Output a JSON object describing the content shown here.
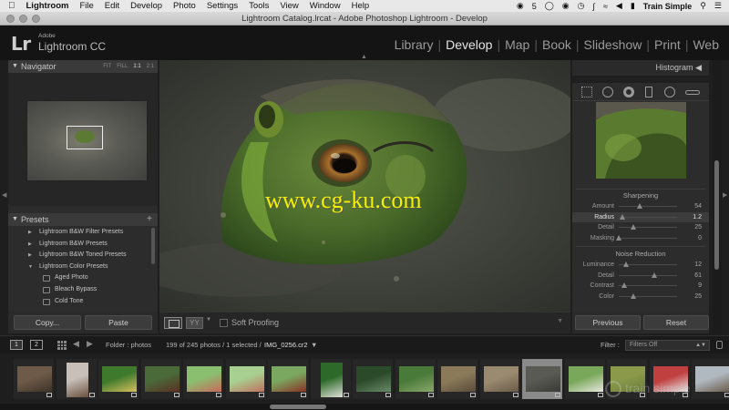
{
  "menubar": {
    "app": "Lightroom",
    "items": [
      "File",
      "Edit",
      "Develop",
      "Photo",
      "Settings",
      "Tools",
      "View",
      "Window",
      "Help"
    ],
    "cc_badge": "5",
    "user": "Train Simple"
  },
  "window": {
    "title": "Lightroom Catalog.lrcat - Adobe Photoshop Lightroom - Develop"
  },
  "identity": {
    "logo": "Lr",
    "adobe": "Adobe",
    "product": "Lightroom CC"
  },
  "modules": [
    {
      "label": "Library",
      "active": false
    },
    {
      "label": "Develop",
      "active": true
    },
    {
      "label": "Map",
      "active": false
    },
    {
      "label": "Book",
      "active": false
    },
    {
      "label": "Slideshow",
      "active": false
    },
    {
      "label": "Print",
      "active": false
    },
    {
      "label": "Web",
      "active": false
    }
  ],
  "navigator": {
    "title": "Navigator",
    "options": [
      "FIT",
      "FILL",
      "1:1",
      "2:1"
    ],
    "selected_option": "1:1"
  },
  "presets": {
    "title": "Presets",
    "add": "+",
    "items": [
      {
        "label": "Lightroom B&W Filter Presets",
        "type": "folder",
        "expanded": false
      },
      {
        "label": "Lightroom B&W Presets",
        "type": "folder",
        "expanded": false
      },
      {
        "label": "Lightroom B&W Toned Presets",
        "type": "folder",
        "expanded": false
      },
      {
        "label": "Lightroom Color Presets",
        "type": "folder",
        "expanded": true
      },
      {
        "label": "Aged Photo",
        "type": "preset"
      },
      {
        "label": "Bleach Bypass",
        "type": "preset"
      },
      {
        "label": "Cold Tone",
        "type": "preset"
      }
    ]
  },
  "left_footer": {
    "copy": "Copy...",
    "paste": "Paste"
  },
  "photo": {
    "watermark": "www.cg-ku.com"
  },
  "toolbar": {
    "yy": "YY",
    "soft_proofing": "Soft Proofing"
  },
  "histogram": {
    "title": "Histogram"
  },
  "sharpening": {
    "title": "Sharpening",
    "sliders": [
      {
        "label": "Amount",
        "value": "54",
        "fraction": 0.36
      },
      {
        "label": "Radius",
        "value": "1.2",
        "fraction": 0.07,
        "active": true
      },
      {
        "label": "Detail",
        "value": "25",
        "fraction": 0.25
      },
      {
        "label": "Masking",
        "value": "0",
        "fraction": 0.0
      }
    ]
  },
  "noise_reduction": {
    "title": "Noise Reduction",
    "sliders": [
      {
        "label": "Luminance",
        "value": "12",
        "fraction": 0.12
      },
      {
        "label": "Detail",
        "value": "61",
        "fraction": 0.61
      },
      {
        "label": "Contrast",
        "value": "9",
        "fraction": 0.09
      },
      {
        "label": "Color",
        "value": "25",
        "fraction": 0.25
      }
    ]
  },
  "right_footer": {
    "previous": "Previous",
    "reset": "Reset"
  },
  "filmstrip_bar": {
    "page1": "1",
    "page2": "2",
    "folder": "Folder : photos",
    "count": "199 of 245 photos / 1 selected /",
    "file": "IMG_0256.cr2",
    "filter_label": "Filter :",
    "filter_value": "Filters Off"
  },
  "filmstrip": {
    "thumbs": [
      {
        "colors": [
          "#6e5a48",
          "#3c3228"
        ],
        "selected": false,
        "portrait": false
      },
      {
        "colors": [
          "#c8c0b8",
          "#6a5040"
        ],
        "selected": false,
        "portrait": true
      },
      {
        "colors": [
          "#3f7a2c",
          "#d8c060"
        ],
        "selected": false,
        "portrait": false
      },
      {
        "colors": [
          "#4a6a3a",
          "#5a3024"
        ],
        "selected": false,
        "portrait": false
      },
      {
        "colors": [
          "#8abf70",
          "#c86a5a"
        ],
        "selected": false,
        "portrait": false
      },
      {
        "colors": [
          "#a8d090",
          "#c07060"
        ],
        "selected": false,
        "portrait": false
      },
      {
        "colors": [
          "#7aa860",
          "#8a3024"
        ],
        "selected": false,
        "portrait": false
      },
      {
        "colors": [
          "#2d6a2a",
          "#e0e0d8"
        ],
        "selected": false,
        "portrait": true
      },
      {
        "colors": [
          "#2a4a2a",
          "#6a8a6a"
        ],
        "selected": false,
        "portrait": false
      },
      {
        "colors": [
          "#4a7a3a",
          "#8aa86a"
        ],
        "selected": false,
        "portrait": false
      },
      {
        "colors": [
          "#8a7a5a",
          "#5a4a3a"
        ],
        "selected": false,
        "portrait": false
      },
      {
        "colors": [
          "#9a8a70",
          "#6a5a48"
        ],
        "selected": false,
        "portrait": false
      },
      {
        "colors": [
          "#5a5a54",
          "#3a3a36"
        ],
        "selected": true,
        "portrait": false
      },
      {
        "colors": [
          "#7aa85a",
          "#e8e8e0"
        ],
        "selected": false,
        "portrait": false
      },
      {
        "colors": [
          "#8a9a4a",
          "#6a7a3a"
        ],
        "selected": false,
        "portrait": false
      },
      {
        "colors": [
          "#c04040",
          "#e8e8e8"
        ],
        "selected": false,
        "portrait": false
      },
      {
        "colors": [
          "#b0b8c0",
          "#6a5a4a"
        ],
        "selected": false,
        "portrait": false
      }
    ]
  },
  "watermark_brand": "train simple"
}
